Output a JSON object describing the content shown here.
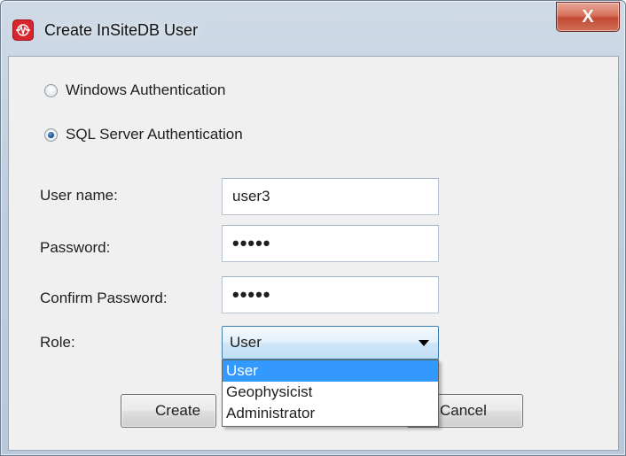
{
  "window": {
    "title": "Create InSiteDB User",
    "close_label": "X"
  },
  "auth": {
    "windows_label": "Windows Authentication",
    "sql_label": "SQL Server Authentication",
    "selected": "sql"
  },
  "form": {
    "username_label": "User name:",
    "username_value": "user3",
    "password_label": "Password:",
    "password_value": "•••••",
    "confirm_label": "Confirm Password:",
    "confirm_value": "•••••",
    "role_label": "Role:",
    "role_value": "User",
    "role_options": [
      "User",
      "Geophysicist",
      "Administrator"
    ]
  },
  "buttons": {
    "create_label": "Create",
    "cancel_label": "Cancel"
  },
  "colors": {
    "accent": "#3399ff",
    "app_icon": "#d8262e",
    "close_button": "#c24a34"
  },
  "icons": {
    "app": "seismic-wave-icon",
    "close": "close-icon",
    "dropdown": "chevron-down-icon"
  }
}
